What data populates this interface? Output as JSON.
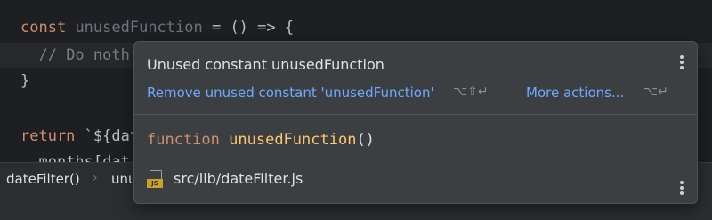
{
  "editor": {
    "line1": {
      "kw": "const",
      "name": "unusedFunction",
      "rest": " = () => {"
    },
    "line2": {
      "comment": "// Do noth"
    },
    "line3": {
      "text": "}"
    },
    "line5": {
      "kw": "return",
      "rest": " `${dat"
    },
    "line6": {
      "text": "months[dat"
    }
  },
  "breadcrumb": {
    "item1": "dateFilter()",
    "separator": "›",
    "item2": "unu"
  },
  "popup": {
    "title": "Unused constant unusedFunction",
    "primary_action": "Remove unused constant 'unusedFunction'",
    "primary_shortcut": "⌥⇧↵",
    "more_actions": "More actions...",
    "more_shortcut": "⌥↵",
    "signature": {
      "keyword": "function",
      "name": "unusedFunction",
      "parens": "()"
    },
    "file": {
      "icon_label": "JS",
      "path": "src/lib/dateFilter.js"
    }
  },
  "colors": {
    "keyword": "#cf8e6d",
    "function_name": "#ffc66d",
    "link": "#6ea8ff",
    "popup_bg": "#3c3f41",
    "editor_bg": "#1e1f22"
  }
}
